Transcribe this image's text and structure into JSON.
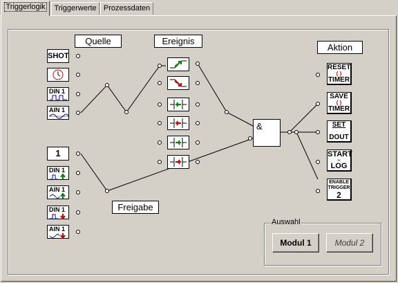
{
  "tabs": [
    {
      "label": "Triggerlogik",
      "active": true
    },
    {
      "label": "Triggerwerte",
      "active": false
    },
    {
      "label": "Prozessdaten",
      "active": false
    }
  ],
  "labels": {
    "quelle": "Quelle",
    "ereignis": "Ereignis",
    "aktion": "Aktion",
    "freigabe": "Freigabe",
    "and": "&"
  },
  "sources": [
    {
      "icon": "shot-icon",
      "text": "SHOT"
    },
    {
      "icon": "clock-icon",
      "text": ""
    },
    {
      "icon": "din1-wave-icon",
      "text": "DIN 1"
    },
    {
      "icon": "ain1-wave-icon",
      "text": "AIN 1"
    }
  ],
  "enables": [
    {
      "icon": "one-icon",
      "text": "1"
    },
    {
      "icon": "din1-up-icon",
      "text": "DIN 1"
    },
    {
      "icon": "ain1-up-icon",
      "text": "AIN 1"
    },
    {
      "icon": "din1-down-icon",
      "text": "DIN 1"
    },
    {
      "icon": "ain1-down-icon",
      "text": "AIN 1"
    }
  ],
  "actions": [
    {
      "icon": "reset-timer-icon",
      "line1": "RESET",
      "line2": "TIMER"
    },
    {
      "icon": "save-timer-icon",
      "line1": "SAVE",
      "line2": "TIMER"
    },
    {
      "icon": "set-dout-icon",
      "line1": "SET",
      "line2": "DOUT"
    },
    {
      "icon": "start-log-icon",
      "line1": "START",
      "line2": "LOG"
    },
    {
      "icon": "enable-trigger-icon",
      "line1": "ENABLE TRIGGER",
      "line2": "2"
    }
  ],
  "auswahl": {
    "title": "Auswahl",
    "modul1": "Modul 1",
    "modul2": "Modul 2"
  },
  "colors": {
    "green": "#008000",
    "red": "#cc0000",
    "blue": "#0000c0"
  }
}
